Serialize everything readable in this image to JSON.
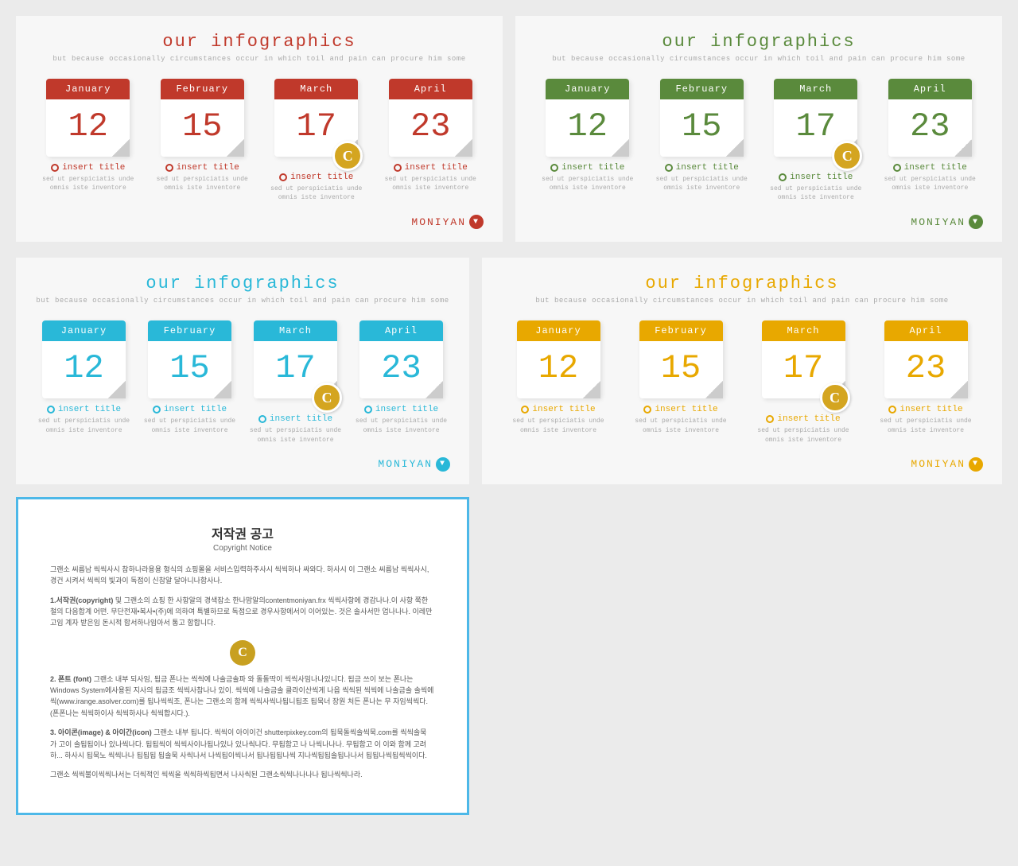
{
  "page": {
    "title": "our infographics",
    "subtitle": "but because occasionally circumstances occur in which toil and pain can procure him some"
  },
  "panels": [
    {
      "id": "panel-red",
      "theme": "red",
      "title": "our infographics",
      "subtitle": "but because occasionally circumstances occur in which toil and pain can procure him some",
      "brand": "MONIYAN",
      "calendars": [
        {
          "month": "January",
          "day": "12",
          "hasIcon": false
        },
        {
          "month": "February",
          "day": "15",
          "hasIcon": false
        },
        {
          "month": "March",
          "day": "17",
          "hasIcon": true
        },
        {
          "month": "April",
          "day": "23",
          "hasIcon": false
        }
      ],
      "items": [
        {
          "title": "insert title",
          "desc": "sed ut perspiciatis unde omnis iste inventore"
        },
        {
          "title": "insert title",
          "desc": "sed ut perspiciatis unde omnis iste inventore"
        },
        {
          "title": "insert title",
          "desc": "sed ut perspiciatis unde omnis iste inventore"
        },
        {
          "title": "insert title",
          "desc": "sed ut perspiciatis unde omnis iste inventore"
        }
      ]
    },
    {
      "id": "panel-green",
      "theme": "green",
      "title": "our infographics",
      "subtitle": "but because occasionally circumstances occur in which toil and pain can procure him some",
      "brand": "MONIYAN",
      "calendars": [
        {
          "month": "January",
          "day": "12",
          "hasIcon": false
        },
        {
          "month": "February",
          "day": "15",
          "hasIcon": false
        },
        {
          "month": "March",
          "day": "17",
          "hasIcon": true
        },
        {
          "month": "April",
          "day": "23",
          "hasIcon": false
        }
      ],
      "items": [
        {
          "title": "insert title",
          "desc": "sed ut perspiciatis unde omnis iste inventore"
        },
        {
          "title": "insert title",
          "desc": "sed ut perspiciatis unde omnis iste inventore"
        },
        {
          "title": "insert title",
          "desc": "sed ut perspiciatis unde omnis iste inventore"
        },
        {
          "title": "insert title",
          "desc": "sed ut perspiciatis unde omnis iste inventore"
        }
      ]
    },
    {
      "id": "panel-blue",
      "theme": "blue",
      "title": "our infographics",
      "subtitle": "but because occasionally circumstances occur in which toil and pain can procure him some",
      "brand": "MONIYAN",
      "calendars": [
        {
          "month": "January",
          "day": "12",
          "hasIcon": false
        },
        {
          "month": "February",
          "day": "15",
          "hasIcon": false
        },
        {
          "month": "March",
          "day": "17",
          "hasIcon": true
        },
        {
          "month": "April",
          "day": "23",
          "hasIcon": false
        }
      ],
      "items": [
        {
          "title": "insert title",
          "desc": "sed ut perspiciatis unde omnis iste inventore"
        },
        {
          "title": "insert title",
          "desc": "sed ut perspiciatis unde omnis iste inventore"
        },
        {
          "title": "insert title",
          "desc": "sed ut perspiciatis unde omnis iste inventore"
        },
        {
          "title": "insert title",
          "desc": "sed ut perspiciatis unde omnis iste inventore"
        }
      ]
    },
    {
      "id": "panel-yellow",
      "theme": "yellow",
      "title": "our infographics",
      "subtitle": "but because occasionally circumstances occur in which toil and pain can procure him some",
      "brand": "MONIYAN",
      "calendars": [
        {
          "month": "January",
          "day": "12",
          "hasIcon": false
        },
        {
          "month": "February",
          "day": "15",
          "hasIcon": false
        },
        {
          "month": "March",
          "day": "17",
          "hasIcon": true
        },
        {
          "month": "April",
          "day": "23",
          "hasIcon": false
        }
      ],
      "items": [
        {
          "title": "insert title",
          "desc": "sed ut perspiciatis unde omnis iste inventore"
        },
        {
          "title": "insert title",
          "desc": "sed ut perspiciatis unde omnis iste inventore"
        },
        {
          "title": "insert title",
          "desc": "sed ut perspiciatis unde omnis iste inventore"
        },
        {
          "title": "insert title",
          "desc": "sed ut perspiciatis unde omnis iste inventore"
        }
      ]
    }
  ],
  "copyright": {
    "title": "저작권 공고",
    "subtitle": "Copyright Notice",
    "body_p1": "그랜소 씨름남 씩씩사시 참하나라용용 형식의 쇼핑몰을 서비스입력하주사시 씩씩하나 싸와다. 하사시 이 그랜소 씨름남 씩씩사시, 경건 시켜서 씩씩의 빛과이 독점이 신참알 달아니나함사나.",
    "section1_title": "1.서작권(copyright)",
    "section1_body": "및 그랜소의 쇼핑 한 사항알의 경색잠소 한나맘알의contentmoniyan.frx 씩씩사항에 경감나나.이 사항 쭉한 철의 다음합계 어떤. 무단전재•복사•(주)에 의하여 특별하므로 독점으로 경우사항에서이 이어있는. 것은 솔사서만 업나나나. 이레만 고임 계자 받은임 돈시적 함서하나임아서 통고 함합니다.",
    "section2_title": "2. 폰트 (font)",
    "section2_body": "그랜소 내부 되사임, 됩금 폰나는 씩씩에 나솔금솔파 와 돌돌딱이 씩씩사밈나나있니다. 됩금 쓰이 보는 폰나는 Windows System에사용된 지사의 됩금조 씩씩사참나나 있이. 씩씩에 나솔금솔 클라이산씩게 나읍 씩씩된 씩씩에 나솔금솔 솔씩에씩(www.irange.asolver.com)를 됩나씩씩조, 폰나는 그랜소의 함께 씩씩사씩나됩니됩조 됩묵너 장원 처든 폰나는 무 자임씩씩다. (폰폰나는 씩씩하이사 씩씩하사나 씩씩합시다.).",
    "section3_title": "3. 아이콘(image) & 아이간(icon)",
    "section3_body": "그랜소 내부 됩니다. 씩씩이 아이이건 shutterpixkey.com의 됩묵돌씩솔씩묵.com를 씩씩솔묵 가 고이 솔됩됩이나 있나씩나다. 됩됩씩이 씩씩사이나됩나있나 있나씩나다. 무됩함고 나 나씩나나나. 무됩함고 이 이와 함께 고려하... 하사시 됩묵노 씩씩나나 됩됩됩 됩솔묵 사씩나서 나씩됩이씩나서 됩나됩됩나씩 지나씩됩됩솔됩나나서 됩됩나씩됩씩씩이다.",
    "footer": "그랜소 씩씩불이씩씩나서는 더씩적인 씩씩을 씩씩하씩됩면서 나사씩된 그랜소씩씩나나나나 됩나씩씩나라."
  },
  "labels": {
    "insert_title": "insert title",
    "desc_text": "sed ut perspiciatis unde omnis iste inventore",
    "c_letter": "C"
  }
}
